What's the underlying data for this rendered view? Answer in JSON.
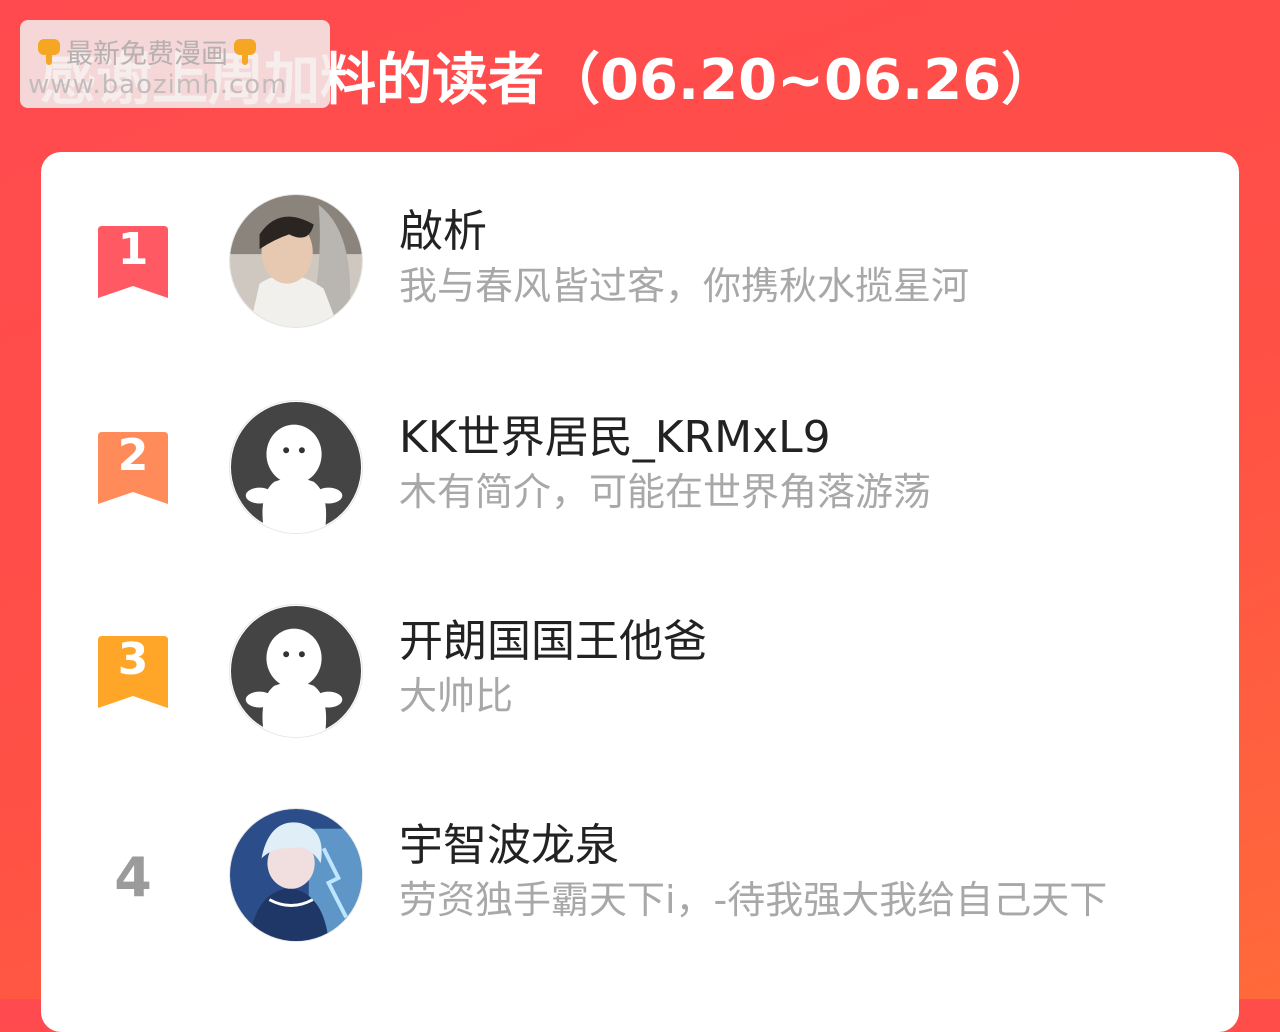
{
  "header": {
    "title": "感谢上周加料的读者（06.20~06.26）"
  },
  "watermark": {
    "line1": "最新免费漫画",
    "line2": "www.baozimh.com",
    "icon": "pointing-down-hand-icon"
  },
  "ranking": [
    {
      "rank": "1",
      "name": "啟析",
      "bio": "我与春风皆过客，你携秋水揽星河",
      "badge_color": "#ff5a64",
      "avatar": "photo-avatar"
    },
    {
      "rank": "2",
      "name": "KK世界居民_KRMxL9",
      "bio": "木有简介，可能在世界角落游荡",
      "badge_color": "#ff8a5a",
      "avatar": "default-avatar"
    },
    {
      "rank": "3",
      "name": "开朗国国王他爸",
      "bio": "大帅比",
      "badge_color": "#ffa628",
      "avatar": "default-avatar"
    },
    {
      "rank": "4",
      "name": "宇智波龙泉",
      "bio": "劳资独手霸天下i，-待我强大我给自己天下",
      "badge_color": "",
      "avatar": "anime-avatar"
    }
  ]
}
